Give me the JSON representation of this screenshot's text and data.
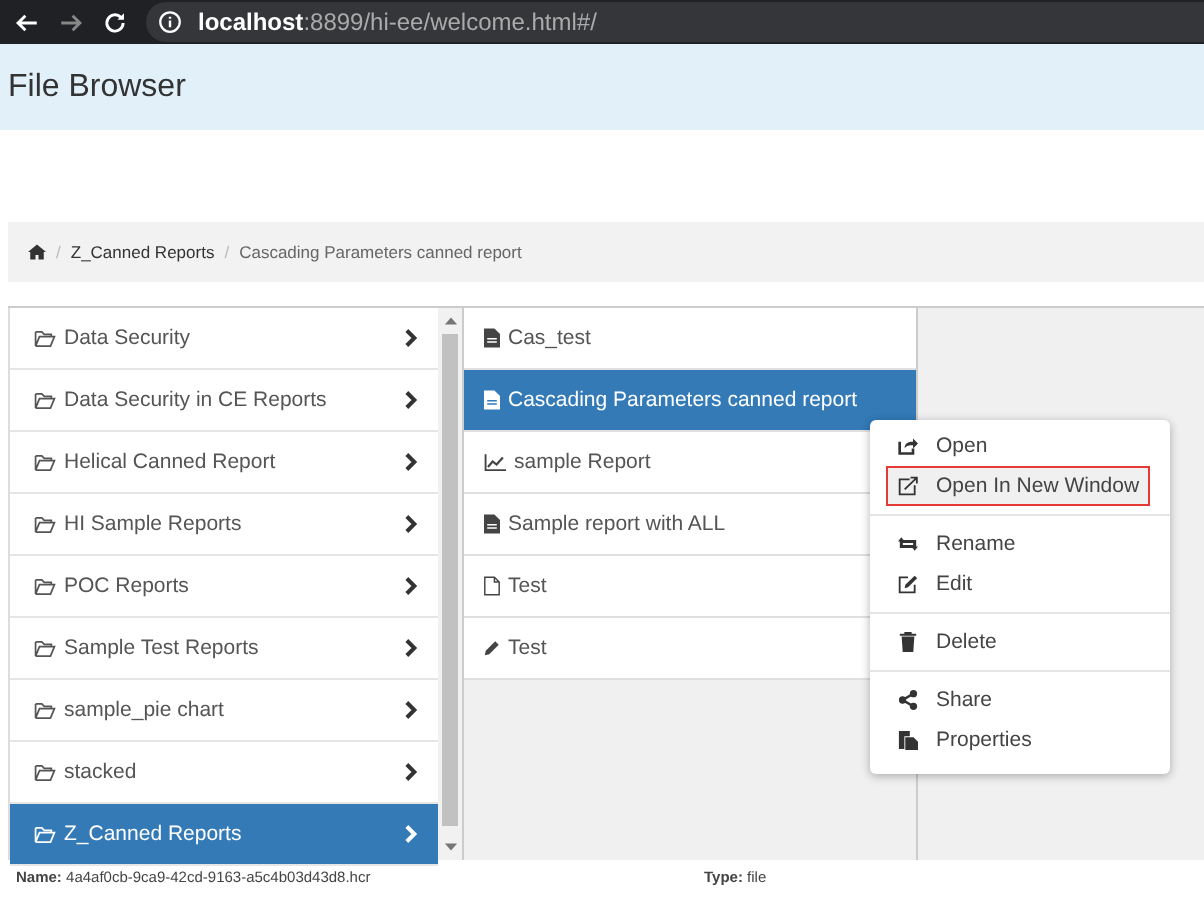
{
  "browser": {
    "url_host": "localhost",
    "url_path": ":8899/hi-ee/welcome.html#/"
  },
  "header": {
    "title": "File Browser"
  },
  "breadcrumb": [
    "Z_Canned Reports",
    "Cascading Parameters canned report"
  ],
  "breadcrumb_separator": "/",
  "folders": [
    {
      "label": "Data Security",
      "selected": false
    },
    {
      "label": "Data Security in CE Reports",
      "selected": false
    },
    {
      "label": "Helical Canned Report",
      "selected": false
    },
    {
      "label": "HI Sample Reports",
      "selected": false
    },
    {
      "label": "POC Reports",
      "selected": false
    },
    {
      "label": "Sample Test Reports",
      "selected": false
    },
    {
      "label": "sample_pie chart",
      "selected": false
    },
    {
      "label": "stacked",
      "selected": false
    },
    {
      "label": "Z_Canned Reports",
      "selected": true
    }
  ],
  "files": [
    {
      "label": "Cas_test",
      "kind": "report",
      "selected": false
    },
    {
      "label": "Cascading Parameters canned report",
      "kind": "report",
      "selected": true
    },
    {
      "label": "sample Report",
      "kind": "chart",
      "selected": false
    },
    {
      "label": "Sample report with ALL",
      "kind": "report",
      "selected": false
    },
    {
      "label": "Test",
      "kind": "blank",
      "selected": false
    },
    {
      "label": "Test",
      "kind": "edit",
      "selected": false
    }
  ],
  "context_menu": [
    [
      {
        "label": "Open",
        "kind": "open",
        "highlighted": false
      },
      {
        "label": "Open In New Window",
        "kind": "newwindow",
        "highlighted": true
      }
    ],
    [
      {
        "label": "Rename",
        "kind": "rename",
        "highlighted": false
      },
      {
        "label": "Edit",
        "kind": "edit",
        "highlighted": false
      }
    ],
    [
      {
        "label": "Delete",
        "kind": "delete",
        "highlighted": false
      }
    ],
    [
      {
        "label": "Share",
        "kind": "share",
        "highlighted": false
      },
      {
        "label": "Properties",
        "kind": "properties",
        "highlighted": false
      }
    ]
  ],
  "footer": {
    "name_label": "Name:",
    "name_value": "4a4af0cb-9ca9-42cd-9163-a5c4b03d43d8.hcr",
    "type_label": "Type:",
    "type_value": "file"
  }
}
